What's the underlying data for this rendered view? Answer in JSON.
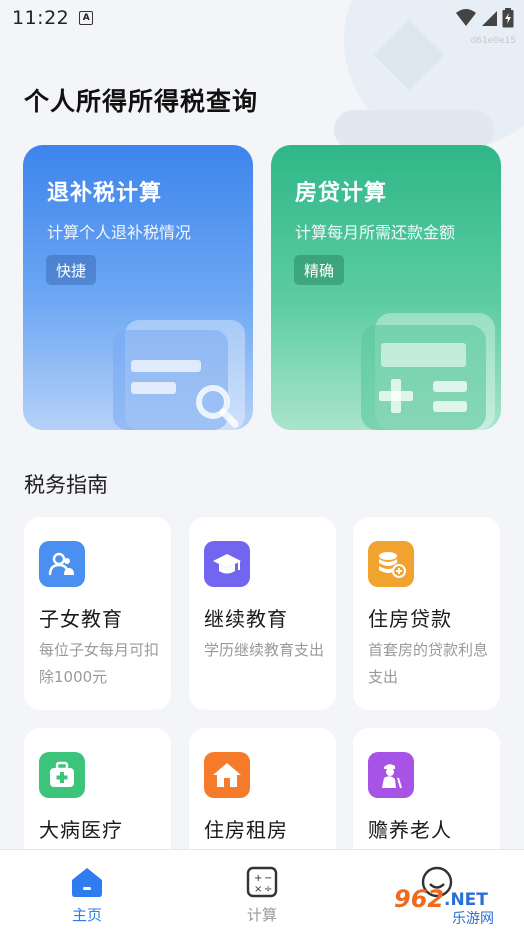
{
  "status_bar": {
    "time": "11:22",
    "a_icon": "A",
    "build_code": "d61e0e15"
  },
  "page": {
    "title": "个人所得所得税查询"
  },
  "cards": [
    {
      "title": "退补税计算",
      "subtitle": "计算个人退补税情况",
      "tag": "快捷",
      "color": "#3d84ec"
    },
    {
      "title": "房贷计算",
      "subtitle": "计算每月所需还款金额",
      "tag": "精确",
      "color": "#2fb788"
    }
  ],
  "guide": {
    "title": "税务指南",
    "items": [
      {
        "title": "子女教育",
        "desc": "每位子女每月可扣除1000元",
        "icon": "children-icon",
        "color": "#4a90f0"
      },
      {
        "title": "继续教育",
        "desc": "学历继续教育支出",
        "icon": "graduation-cap-icon",
        "color": "#7266f0"
      },
      {
        "title": "住房贷款",
        "desc": "首套房的贷款利息支出",
        "icon": "coins-icon",
        "color": "#f0a32e"
      },
      {
        "title": "大病医疗",
        "desc": "",
        "icon": "medical-kit-icon",
        "color": "#3cc47a"
      },
      {
        "title": "住房租房",
        "desc": "",
        "icon": "house-icon",
        "color": "#f57a2a"
      },
      {
        "title": "赡养老人",
        "desc": "",
        "icon": "elderly-icon",
        "color": "#a653e6"
      }
    ]
  },
  "bottom_nav": {
    "items": [
      {
        "label": "主页",
        "active": true
      },
      {
        "label": "计算",
        "active": false
      }
    ],
    "active_color": "#2f7cf0",
    "inactive_color": "#9a9a9a"
  },
  "watermark": {
    "brand": "962",
    "suffix": ".NET",
    "tagline": "乐游网"
  }
}
